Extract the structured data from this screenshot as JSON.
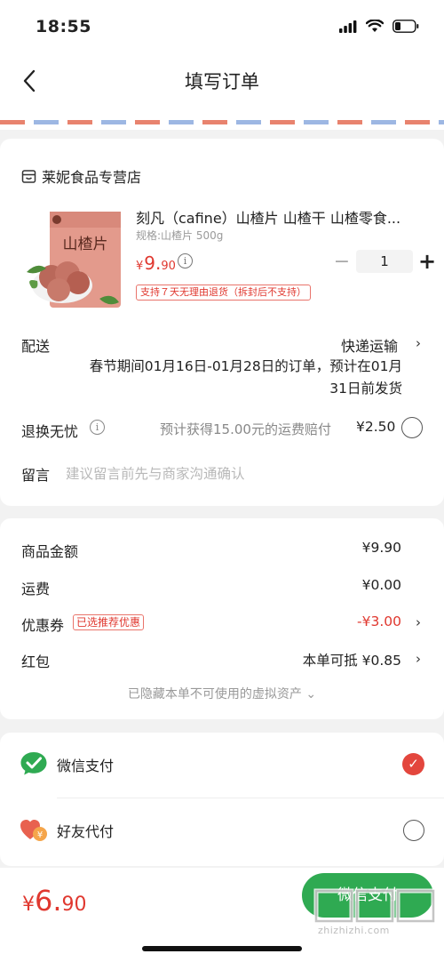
{
  "status_bar": {
    "time": "18:55"
  },
  "nav": {
    "title": "填写订单"
  },
  "store": {
    "name": "莱妮食品专营店"
  },
  "product": {
    "title": "刻凡（cafine）山楂片 山楂干 山楂零食...",
    "spec": "规格:山楂片 500g",
    "price_currency": "¥",
    "price_int": "9.",
    "price_dec": "90",
    "quantity": "1",
    "refund_tag": "支持７天无理由退货（拆封后不支持）",
    "image_text": "山楂片"
  },
  "shipping": {
    "label": "配送",
    "method": "快递运输",
    "note": "春节期间01月16日-01月28日的订单，预计在01月31日前发货"
  },
  "refund_protect": {
    "label": "退换无忧",
    "text": "预计获得15.00元的运费赔付",
    "price": "¥2.50"
  },
  "remark": {
    "label": "留言",
    "placeholder": "建议留言前先与商家沟通确认"
  },
  "summary": {
    "goods_label": "商品金额",
    "goods_value": "¥9.90",
    "freight_label": "运费",
    "freight_value": "¥0.00",
    "coupon_label": "优惠券",
    "coupon_tag": "已选推荐优惠",
    "coupon_value": "-¥3.00",
    "redpacket_label": "红包",
    "redpacket_value": "本单可抵 ¥0.85",
    "hidden_assets": "已隐藏本单不可使用的虚拟资产 ⌄"
  },
  "payment": {
    "wechat_label": "微信支付",
    "wechat_selected": true,
    "friend_label": "好友代付",
    "friend_selected": false
  },
  "bottom": {
    "total_currency": "¥",
    "total_int": "6.",
    "total_dec": "90",
    "pay_button": "微信支付",
    "watermark": "zhizhizhi.com"
  },
  "colors": {
    "price_red": "#e0382f",
    "wechat_green": "#2faa52",
    "check_red": "#e3463d"
  }
}
